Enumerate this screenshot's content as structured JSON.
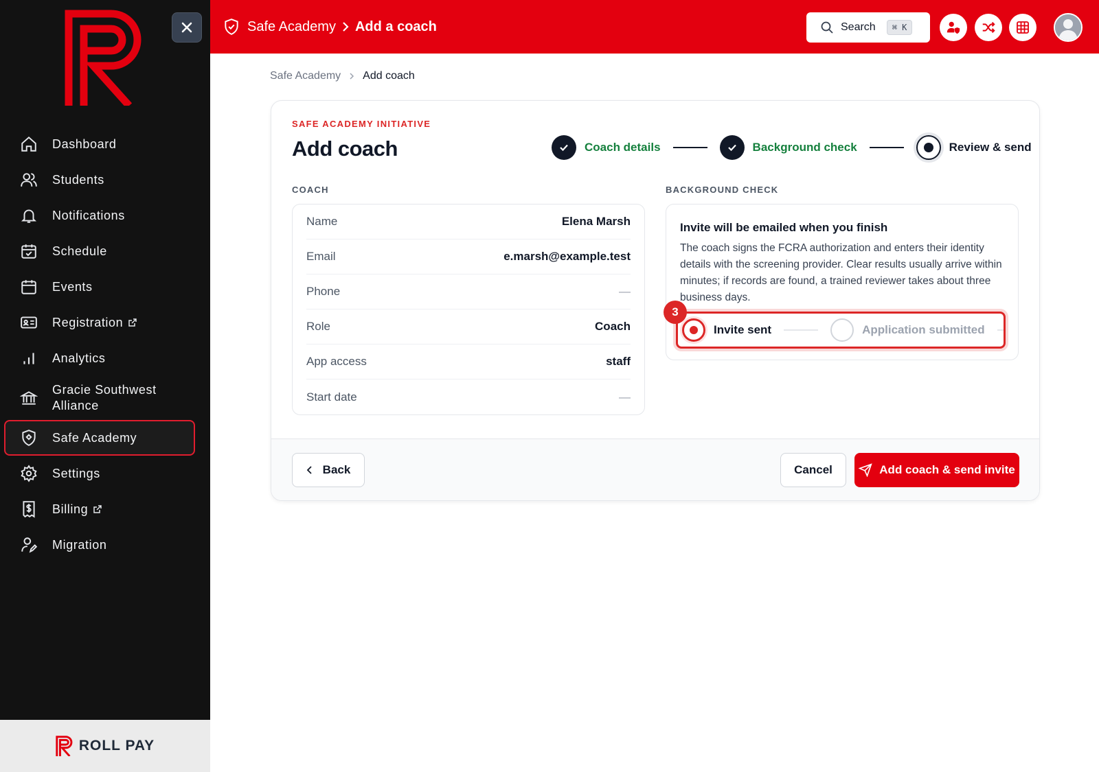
{
  "brand": {
    "footer_name": "ROLL PAY",
    "accent": "#e3000f",
    "sidebar_bg": "#121212",
    "success": "#15803d"
  },
  "sidebar": {
    "items": [
      {
        "label": "Dashboard",
        "icon": "home-icon"
      },
      {
        "label": "Students",
        "icon": "users-icon"
      },
      {
        "label": "Notifications",
        "icon": "bell-icon"
      },
      {
        "label": "Schedule",
        "icon": "calendar-check-icon"
      },
      {
        "label": "Events",
        "icon": "calendar-icon"
      },
      {
        "label": "Registration",
        "icon": "id-card-icon",
        "external": true
      },
      {
        "label": "Analytics",
        "icon": "bar-chart-icon"
      },
      {
        "label": "Gracie Southwest Alliance",
        "icon": "bank-icon"
      },
      {
        "label": "Safe Academy",
        "icon": "shield-icon",
        "active": true
      },
      {
        "label": "Settings",
        "icon": "gear-icon"
      },
      {
        "label": "Billing",
        "icon": "receipt-dollar-icon",
        "external": true
      },
      {
        "label": "Migration",
        "icon": "user-edit-icon"
      }
    ]
  },
  "header": {
    "section": "Safe Academy",
    "page": "Add a coach",
    "search_label": "Search",
    "search_shortcut": "⌘ K"
  },
  "breadcrumb": {
    "parent": "Safe Academy",
    "current": "Add coach"
  },
  "form": {
    "eyebrow": "SAFE ACADEMY INITIATIVE",
    "title": "Add coach",
    "steps": [
      {
        "label": "Coach details",
        "status": "done"
      },
      {
        "label": "Background check",
        "status": "done"
      },
      {
        "label": "Review & send",
        "status": "current"
      }
    ],
    "coach_section": "COACH",
    "coach_rows": [
      {
        "label": "Name",
        "value": "Elena Marsh"
      },
      {
        "label": "Email",
        "value": "e.marsh@example.test"
      },
      {
        "label": "Phone",
        "value": "—"
      },
      {
        "label": "Role",
        "value": "Coach"
      },
      {
        "label": "App access",
        "value": "staff"
      },
      {
        "label": "Start date",
        "value": "—"
      }
    ],
    "bg_section": "BACKGROUND CHECK",
    "bg_title": "Invite will be emailed when you finish",
    "bg_description": "The coach signs the FCRA authorization and enters their identity details with the screening provider. Clear results usually arrive within minutes; if records are found, a trained reviewer takes about three business days.",
    "bg_badge": "3",
    "bg_progress": [
      {
        "label": "Invite sent",
        "status": "active"
      },
      {
        "label": "Application submitted",
        "status": "idle"
      }
    ]
  },
  "footer": {
    "back_label": "Back",
    "cancel_label": "Cancel",
    "submit_label": "Add coach & send invite"
  }
}
